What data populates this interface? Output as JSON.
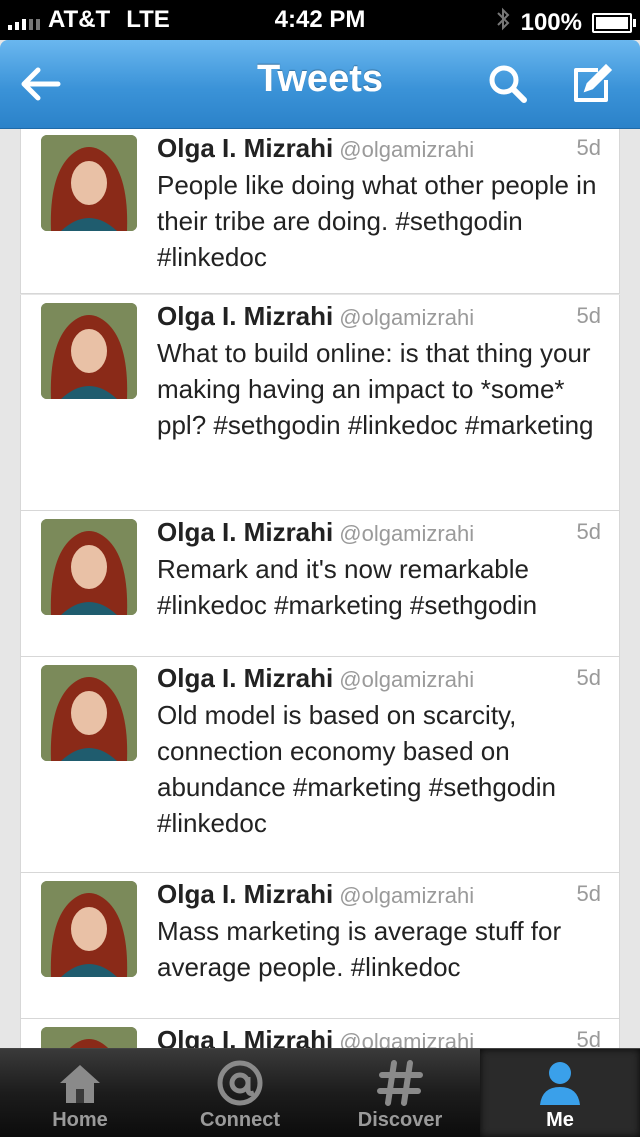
{
  "status_bar": {
    "carrier": "AT&T",
    "network": "LTE",
    "time": "4:42 PM",
    "battery": "100%",
    "battery_level": 1.0
  },
  "nav": {
    "title": "Tweets",
    "back_icon": "back-arrow-icon",
    "search_icon": "search-icon",
    "compose_icon": "compose-icon",
    "accent": "#3b93d8"
  },
  "tweets": [
    {
      "name": "Olga I. Mizrahi",
      "handle": "@olgamizrahi",
      "age": "5d",
      "text": "People like doing what other people in their tribe are doing. #sethgodin #linkedoc"
    },
    {
      "name": "Olga I. Mizrahi",
      "handle": "@olgamizrahi",
      "age": "5d",
      "text": "What to build online: is that thing your making having an impact to *some* ppl? #sethgodin #linkedoc #marketing"
    },
    {
      "name": "Olga I. Mizrahi",
      "handle": "@olgamizrahi",
      "age": "5d",
      "text": "Remark and it's now remarkable #linkedoc #marketing #sethgodin"
    },
    {
      "name": "Olga I. Mizrahi",
      "handle": "@olgamizrahi",
      "age": "5d",
      "text": "Old model is based on scarcity, connection economy based on abundance #marketing #sethgodin #linkedoc"
    },
    {
      "name": "Olga I. Mizrahi",
      "handle": "@olgamizrahi",
      "age": "5d",
      "text": "Mass marketing is average stuff for average people.  #linkedoc"
    },
    {
      "name": "Olga I. Mizrahi",
      "handle": "@olgamizrahi",
      "age": "5d",
      "text": ""
    }
  ],
  "tab_bar": {
    "tabs": [
      {
        "label": "Home",
        "icon": "home-icon",
        "active": false
      },
      {
        "label": "Connect",
        "icon": "at-icon",
        "active": false
      },
      {
        "label": "Discover",
        "icon": "hashtag-icon",
        "active": false
      },
      {
        "label": "Me",
        "icon": "person-icon",
        "active": true
      }
    ]
  }
}
